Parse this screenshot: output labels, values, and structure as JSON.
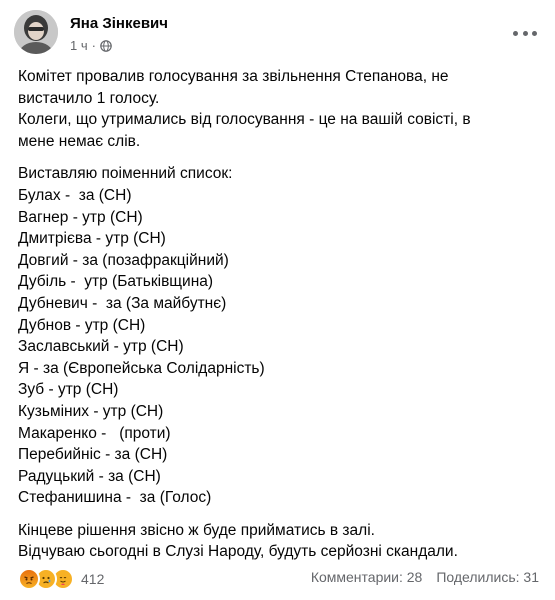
{
  "post": {
    "author": "Яна Зінкевич",
    "time": "1 ч",
    "paragraph1": [
      "Комітет провалив голосування за звільнення Степанова, не",
      "вистачило 1 голосу.",
      "Колеги, що утримались від голосування - це на вашій совісті, в",
      "мене немає слів."
    ],
    "list_intro": "Виставляю поіменний список:",
    "votes": [
      "Булах -  за (СН)",
      "Вагнер - утр (СН)",
      "Дмитрієва - утр (СН)",
      "Довгий - за (позафракційний)",
      "Дубіль -  утр (Батьківщина)",
      "Дубневич -  за (За майбутнє)",
      "Дубнов - утр (СН)",
      "Заславський - утр (СН)",
      "Я - за (Європейська Солідарність)",
      "Зуб - утр (СН)",
      "Кузьміних - утр (СН)",
      "Макаренко -   (проти)",
      "Перебийніс - за (СН)",
      "Радуцький - за (СН)",
      "Стефанишина -  за (Голос)"
    ],
    "closing": [
      "Кінцеве рішення звісно ж буде прийматись в залі.",
      "Відчуваю сьогодні в Слузі Народу, будуть серйозні скандали."
    ]
  },
  "footer": {
    "reaction_count": "412",
    "comments": "Комментарии: 28",
    "shares": "Поделились: 31"
  },
  "icons": [
    "globe-icon",
    "more-options-icon",
    "angry-reaction-icon",
    "sad-reaction-icon",
    "care-reaction-icon"
  ],
  "colors": {
    "text": "#050505",
    "secondary": "#65676b",
    "angry": "#e9710f",
    "reaction_yellow": "#f7b125"
  }
}
